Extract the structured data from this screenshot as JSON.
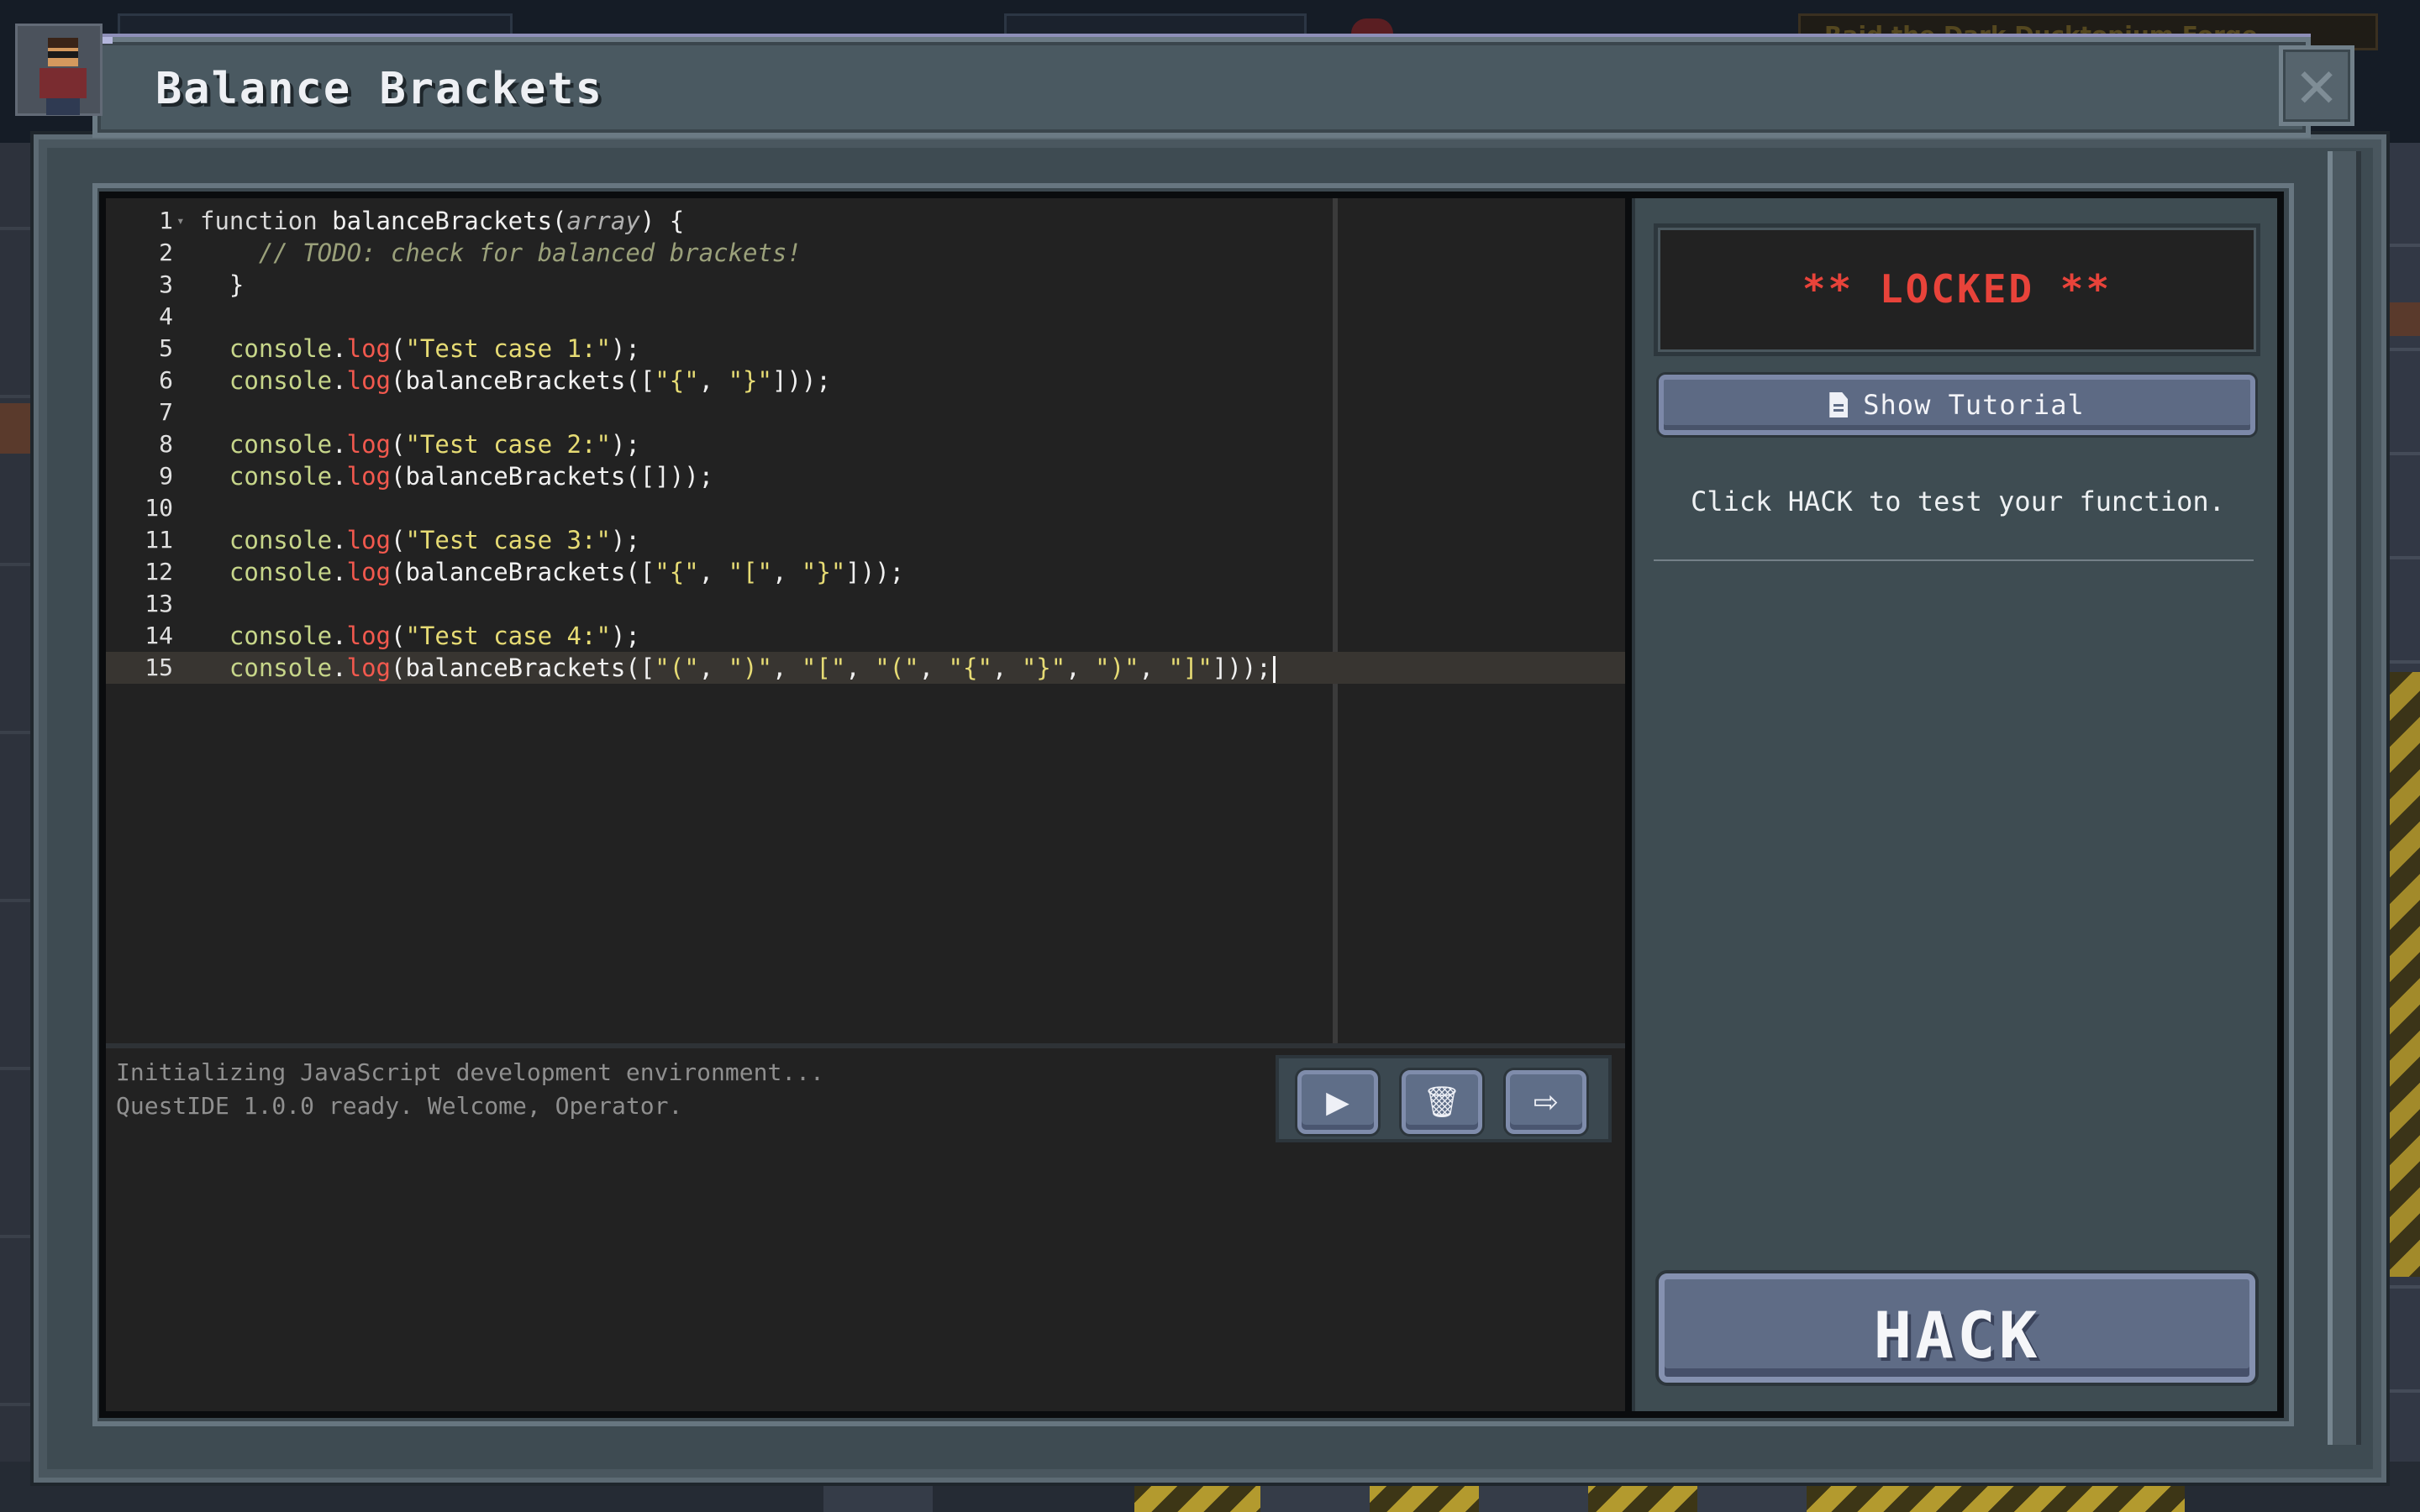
{
  "window": {
    "title": "Balance Brackets",
    "close_glyph": "✕"
  },
  "background": {
    "quest_text": "Raid the Dark Ducktopium Forge"
  },
  "editor": {
    "lines": [
      {
        "number": "1",
        "tokens": [
          {
            "t": "function ",
            "c": "kw"
          },
          {
            "t": "balanceBrackets",
            "c": "fn"
          },
          {
            "t": "(",
            "c": "pun"
          },
          {
            "t": "array",
            "c": "param"
          },
          {
            "t": ") {",
            "c": "pun"
          }
        ],
        "fold": true
      },
      {
        "number": "2",
        "tokens": [
          {
            "t": "    // TODO: check for balanced brackets!",
            "c": "cm"
          }
        ]
      },
      {
        "number": "3",
        "tokens": [
          {
            "t": "  }",
            "c": "pun"
          }
        ]
      },
      {
        "number": "4",
        "tokens": []
      },
      {
        "number": "5",
        "tokens": [
          {
            "t": "  console",
            "c": "obj"
          },
          {
            "t": ".",
            "c": "pun"
          },
          {
            "t": "log",
            "c": "meth"
          },
          {
            "t": "(",
            "c": "pun"
          },
          {
            "t": "\"Test case 1:\"",
            "c": "str"
          },
          {
            "t": ");",
            "c": "pun"
          }
        ]
      },
      {
        "number": "6",
        "tokens": [
          {
            "t": "  console",
            "c": "obj"
          },
          {
            "t": ".",
            "c": "pun"
          },
          {
            "t": "log",
            "c": "meth"
          },
          {
            "t": "(balanceBrackets([",
            "c": "pun"
          },
          {
            "t": "\"{\"",
            "c": "str"
          },
          {
            "t": ", ",
            "c": "pun"
          },
          {
            "t": "\"}\"",
            "c": "str"
          },
          {
            "t": "]));",
            "c": "pun"
          }
        ]
      },
      {
        "number": "7",
        "tokens": []
      },
      {
        "number": "8",
        "tokens": [
          {
            "t": "  console",
            "c": "obj"
          },
          {
            "t": ".",
            "c": "pun"
          },
          {
            "t": "log",
            "c": "meth"
          },
          {
            "t": "(",
            "c": "pun"
          },
          {
            "t": "\"Test case 2:\"",
            "c": "str"
          },
          {
            "t": ");",
            "c": "pun"
          }
        ]
      },
      {
        "number": "9",
        "tokens": [
          {
            "t": "  console",
            "c": "obj"
          },
          {
            "t": ".",
            "c": "pun"
          },
          {
            "t": "log",
            "c": "meth"
          },
          {
            "t": "(balanceBrackets([]));",
            "c": "pun"
          }
        ]
      },
      {
        "number": "10",
        "tokens": []
      },
      {
        "number": "11",
        "tokens": [
          {
            "t": "  console",
            "c": "obj"
          },
          {
            "t": ".",
            "c": "pun"
          },
          {
            "t": "log",
            "c": "meth"
          },
          {
            "t": "(",
            "c": "pun"
          },
          {
            "t": "\"Test case 3:\"",
            "c": "str"
          },
          {
            "t": ");",
            "c": "pun"
          }
        ]
      },
      {
        "number": "12",
        "tokens": [
          {
            "t": "  console",
            "c": "obj"
          },
          {
            "t": ".",
            "c": "pun"
          },
          {
            "t": "log",
            "c": "meth"
          },
          {
            "t": "(balanceBrackets([",
            "c": "pun"
          },
          {
            "t": "\"{\"",
            "c": "str"
          },
          {
            "t": ", ",
            "c": "pun"
          },
          {
            "t": "\"[\"",
            "c": "str"
          },
          {
            "t": ", ",
            "c": "pun"
          },
          {
            "t": "\"}\"",
            "c": "str"
          },
          {
            "t": "]));",
            "c": "pun"
          }
        ]
      },
      {
        "number": "13",
        "tokens": []
      },
      {
        "number": "14",
        "tokens": [
          {
            "t": "  console",
            "c": "obj"
          },
          {
            "t": ".",
            "c": "pun"
          },
          {
            "t": "log",
            "c": "meth"
          },
          {
            "t": "(",
            "c": "pun"
          },
          {
            "t": "\"Test case 4:\"",
            "c": "str"
          },
          {
            "t": ");",
            "c": "pun"
          }
        ]
      },
      {
        "number": "15",
        "active": true,
        "tokens": [
          {
            "t": "  console",
            "c": "obj"
          },
          {
            "t": ".",
            "c": "pun"
          },
          {
            "t": "log",
            "c": "meth"
          },
          {
            "t": "(balanceBrackets([",
            "c": "pun"
          },
          {
            "t": "\"(\"",
            "c": "str"
          },
          {
            "t": ", ",
            "c": "pun"
          },
          {
            "t": "\")\"",
            "c": "str"
          },
          {
            "t": ", ",
            "c": "pun"
          },
          {
            "t": "\"[\"",
            "c": "str"
          },
          {
            "t": ", ",
            "c": "pun"
          },
          {
            "t": "\"(\"",
            "c": "str"
          },
          {
            "t": ", ",
            "c": "pun"
          },
          {
            "t": "\"{\"",
            "c": "str"
          },
          {
            "t": ", ",
            "c": "pun"
          },
          {
            "t": "\"}\"",
            "c": "str"
          },
          {
            "t": ", ",
            "c": "pun"
          },
          {
            "t": "\")\"",
            "c": "str"
          },
          {
            "t": ", ",
            "c": "pun"
          },
          {
            "t": "\"]\"",
            "c": "str"
          },
          {
            "t": "]));",
            "c": "pun"
          }
        ]
      }
    ]
  },
  "console": {
    "lines": [
      "Initializing JavaScript development environment...",
      "QuestIDE 1.0.0 ready. Welcome, Operator."
    ],
    "tools": [
      {
        "name": "run-button",
        "icon": "play-icon",
        "glyph": "▶"
      },
      {
        "name": "clear-button",
        "icon": "trash-icon",
        "glyph": "🗑"
      },
      {
        "name": "exit-button",
        "icon": "exit-icon",
        "glyph": "⇨"
      }
    ]
  },
  "panel": {
    "status": "** LOCKED **",
    "tutorial_label": "Show Tutorial",
    "tutorial_icon": "document-icon",
    "instruction": "Click HACK to test your function.",
    "hack_label": "HACK"
  },
  "colors": {
    "locked_red": "#e8433a",
    "button_blue": "#5f6c86",
    "editor_bg": "#222222",
    "string_yellow": "#e6db74",
    "method_red": "#f2594e"
  }
}
